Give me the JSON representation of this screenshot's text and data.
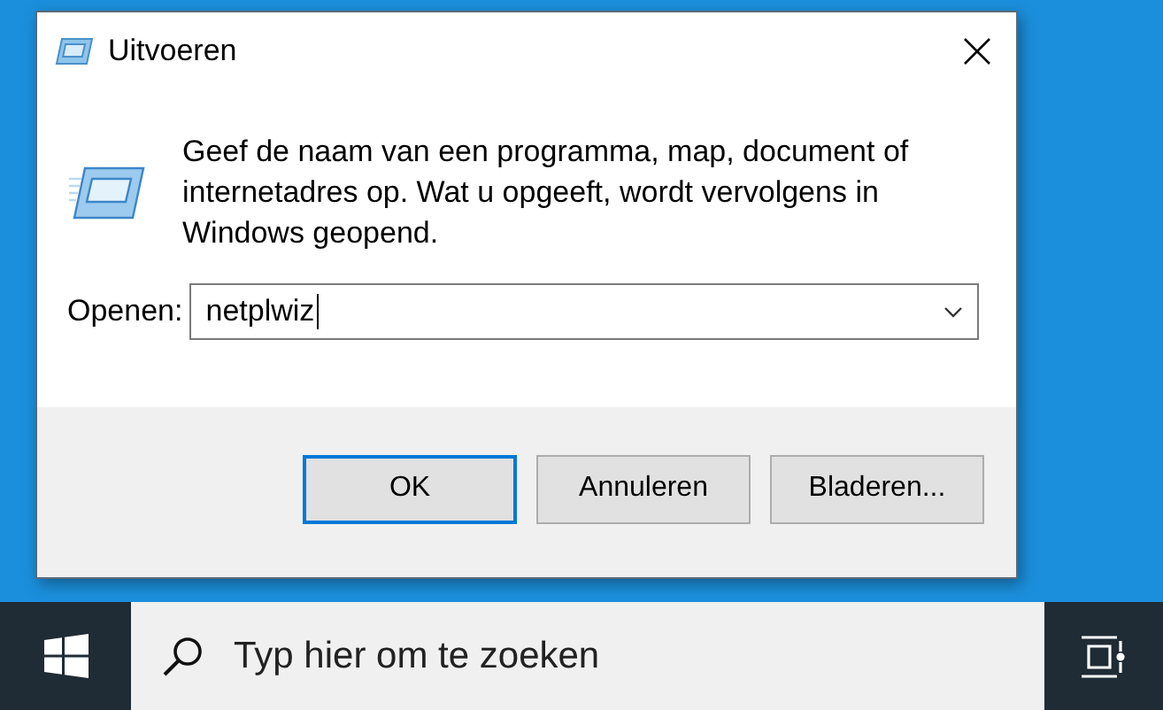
{
  "window": {
    "title": "Uitvoeren"
  },
  "dialog": {
    "message": "Geef de naam van een programma, map, document of internetadres op. Wat u opgeeft, wordt vervolgens in Windows geopend.",
    "open_label": "Openen:",
    "open_value": "netplwiz"
  },
  "buttons": [
    {
      "label": "OK",
      "default": true
    },
    {
      "label": "Annuleren",
      "default": false
    },
    {
      "label": "Bladeren...",
      "default": false
    }
  ],
  "taskbar": {
    "search": {
      "placeholder": "Typ hier om te zoeken"
    }
  }
}
